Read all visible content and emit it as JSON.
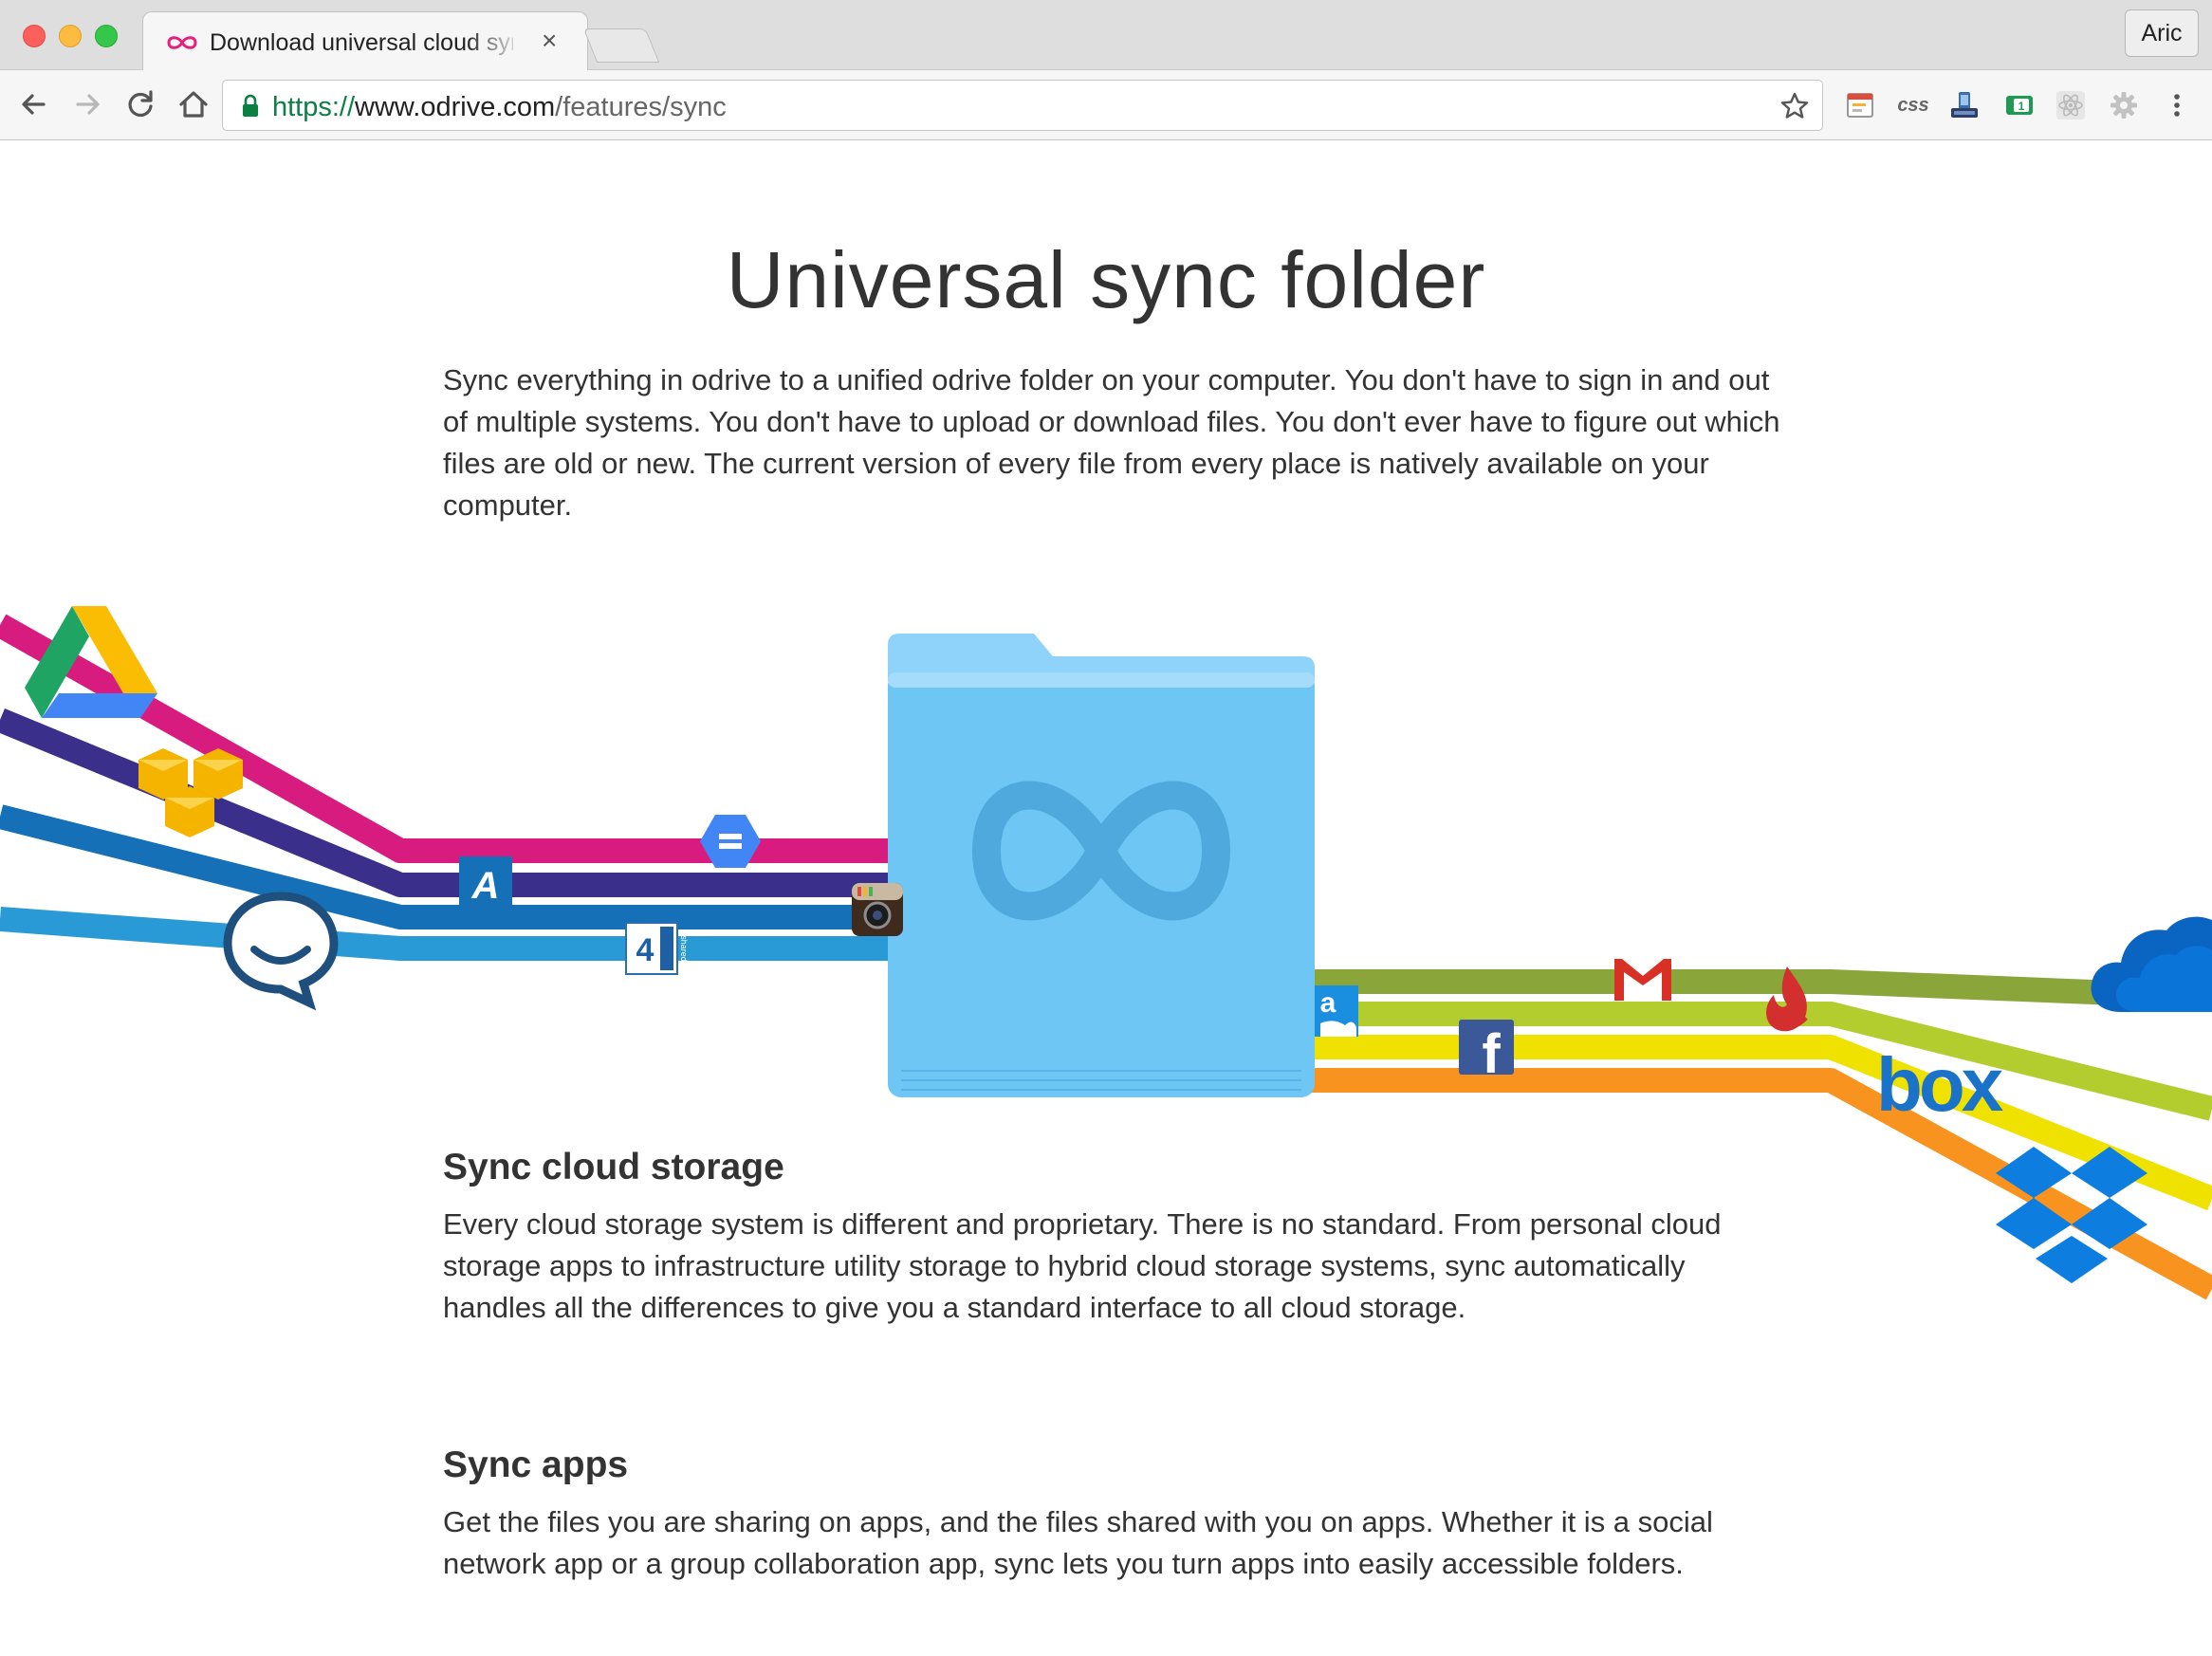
{
  "browser": {
    "tab_title": "Download universal cloud sync",
    "tab_close": "×",
    "profile_name": "Aric",
    "url": {
      "scheme": "https://",
      "host": "www.odrive.com",
      "path": "/features/sync"
    },
    "ext_css_label": "css",
    "ext_badge": "1"
  },
  "page": {
    "headline": "Universal sync folder",
    "intro": "Sync everything in odrive to a unified odrive folder on your computer. You don't have to sign in and out of multiple systems. You don't have to upload or download files. You don't ever have to figure out which files are old or new.     The current version of every file from every place is natively available on your computer.",
    "sections": [
      {
        "heading": "Sync cloud storage",
        "body": "Every cloud storage system is different and proprietary. There is no standard. From personal cloud storage apps to infrastructure utility storage to hybrid cloud storage systems, sync automatically handles all the differences to give you a standard interface to all cloud storage."
      },
      {
        "heading": "Sync apps",
        "body": "Get the files you are sharing on apps, and the files shared with you on apps. Whether it is a social network app or a group collaboration app, sync lets you turn apps into easily accessible folders."
      }
    ]
  },
  "illustration": {
    "left_icons": [
      "google-drive-icon",
      "amazon-s3-icon",
      "hipchat-icon",
      "adrive-icon",
      "google-cloud-storage-icon",
      "4shared-icon",
      "instagram-icon"
    ],
    "right_icons": [
      "amazon-cloud-drive-icon",
      "facebook-icon",
      "gmail-icon",
      "sugarsync-icon",
      "box-icon",
      "onedrive-icon",
      "dropbox-icon"
    ],
    "labels": {
      "adrive": "A",
      "fourshared": "4",
      "fourshared_small": "shared",
      "amazon": "a",
      "facebook": "f",
      "box": "box"
    },
    "colors": {
      "magenta": "#d81b7e",
      "indigo": "#3a2f8a",
      "blue": "#1670b8",
      "skyblue": "#2a9ad6",
      "olive": "#8aa63a",
      "lime": "#b3cc2e",
      "yellow": "#f0e200",
      "orange": "#f7931e",
      "folder": "#6ec6f5"
    }
  }
}
